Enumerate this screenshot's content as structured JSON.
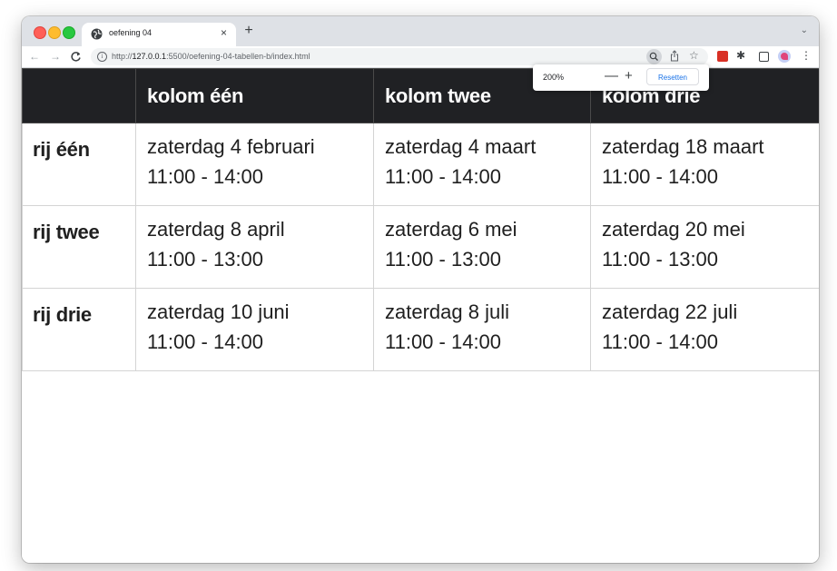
{
  "browser": {
    "tab": {
      "title": "oefening 04",
      "close_glyph": "×"
    },
    "new_tab_glyph": "+",
    "tab_menu_glyph": "⌄",
    "url_prefix": "http://",
    "url_host": "127.0.0.1",
    "url_rest": ":5500/oefening-04-tabellen-b/index.html",
    "nav": {
      "back_glyph": "←",
      "forward_glyph": "→",
      "reload_glyph": "C"
    },
    "icons": [
      "zoom-icon",
      "share-icon",
      "star-icon",
      "extension-icon",
      "puzzle-icon",
      "side-panel-icon",
      "profile-avatar",
      "more-menu-icon"
    ]
  },
  "zoom_popup": {
    "level": "200%",
    "minus_glyph": "—",
    "plus_glyph": "+",
    "reset_label": "Resetten"
  },
  "table": {
    "headers": [
      "",
      "kolom één",
      "kolom twee",
      "kolom drie"
    ],
    "rows": [
      {
        "label": "rij één",
        "cells": [
          {
            "date": "zaterdag 4 februari",
            "time": "11:00 - 14:00"
          },
          {
            "date": "zaterdag 4 maart",
            "time": "11:00 - 14:00"
          },
          {
            "date": "zaterdag 18 maart",
            "time": "11:00 - 14:00"
          }
        ]
      },
      {
        "label": "rij twee",
        "cells": [
          {
            "date": "zaterdag 8 april",
            "time": "11:00 - 13:00"
          },
          {
            "date": "zaterdag 6 mei",
            "time": "11:00 - 13:00"
          },
          {
            "date": "zaterdag 20 mei",
            "time": "11:00 - 13:00"
          }
        ]
      },
      {
        "label": "rij drie",
        "cells": [
          {
            "date": "zaterdag 10 juni",
            "time": "11:00 - 14:00"
          },
          {
            "date": "zaterdag 8 juli",
            "time": "11:00 - 14:00"
          },
          {
            "date": "zaterdag 22 juli",
            "time": "11:00 - 14:00"
          }
        ]
      }
    ]
  },
  "colors": {
    "header_bg": "#202124",
    "header_text": "#ffffff",
    "accent": "#1a73e8"
  }
}
